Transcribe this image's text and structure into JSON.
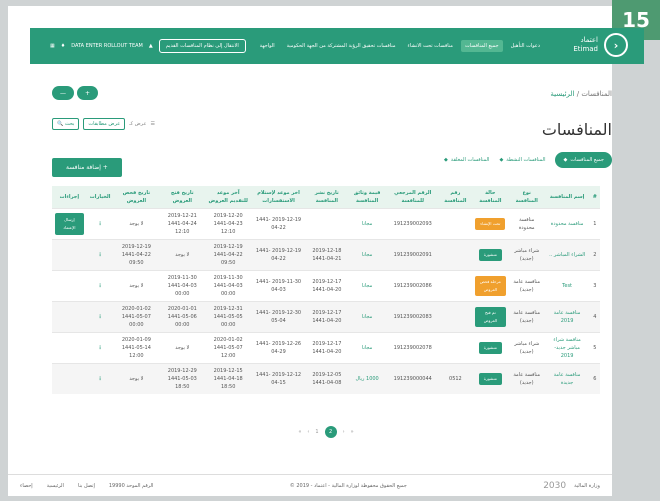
{
  "badge": "15",
  "topbar": {
    "logo_ar": "اعتماد",
    "logo_en": "Etimad",
    "nav": [
      {
        "label": "دعوات التأهيل",
        "active": false
      },
      {
        "label": "جميع المنافسات",
        "active": true
      },
      {
        "label": "منافسات تحت الانشاء",
        "active": false
      },
      {
        "label": "منافسات تحقيق الرؤية المشتركة من الجهة الحكومية",
        "active": false
      }
    ],
    "dashboard_label": "الواجهة",
    "legacy_button": "الانتقال إلى نظام المنافسات القديم",
    "user": "DATA ENTER ROLLOUT TEAM"
  },
  "breadcrumb": {
    "home": "الرئيسية",
    "sep": "/",
    "current": "المنافسات"
  },
  "pills": {
    "plus": "+",
    "collapse": "—"
  },
  "page_title": "المنافسات",
  "view": {
    "label": "عرض كـ",
    "search_label": "بحث",
    "display_label": "عرض مطابقات"
  },
  "tabs": [
    {
      "label": "جميع المنافسات",
      "active": true
    },
    {
      "label": "المنافسات النشطة",
      "active": false
    },
    {
      "label": "المنافسات المغلقة",
      "active": false
    }
  ],
  "add_button": "إضافة منافسة +",
  "table": {
    "headers": [
      "#",
      "إسم المنافسة",
      "نوع المنافسة",
      "حالة المنافسة",
      "رقم المنافسة",
      "الرقم المرجعي للمنافسة",
      "قيمة وثائق المنافسة",
      "تاريخ نشر المنافسة",
      "اخر موعد لإستلام الاستفسارات",
      "آخر موعد للتقديم العروض",
      "تاريخ فتح العروض",
      "تاريخ فحص العروض",
      "الخيارات",
      "إجراءات"
    ],
    "rows": [
      {
        "no": "1",
        "name": "منافسة محدودة",
        "type": "منافسة محدودة",
        "status": "تحت الإنشاء",
        "status_color": "#f0a02e",
        "number": "",
        "ref": "191239002093",
        "value": "مجانا",
        "published": "",
        "inquiries": "2019-12-19 1441-04-22",
        "submit": "2019-12-20 1441-04-23 12:10",
        "open": "2019-12-21 1441-04-24 12:10",
        "exam": "لا يوجد",
        "action": "إرسال الإعتماد"
      },
      {
        "no": "2",
        "name": "الشراء المباشر ..",
        "type": "شراء مباشر (جديد)",
        "status": "منشورة",
        "status_color": "#2a9b7a",
        "number": "",
        "ref": "191239002091",
        "value": "مجانا",
        "published": "2019-12-18 1441-04-21",
        "inquiries": "2019-12-19 1441-04-22",
        "submit": "2019-12-19 1441-04-22 09:50",
        "open": "لا يوجد",
        "exam": "2019-12-19 1441-04-22 09:50",
        "action": ""
      },
      {
        "no": "3",
        "name": "Test",
        "type": "منافسة عامة (جديد)",
        "status": "مرحلة فحص العروض",
        "status_color": "#f0a02e",
        "number": "",
        "ref": "191239002086",
        "value": "مجانا",
        "published": "2019-12-17 1441-04-20",
        "inquiries": "2019-11-30 1441-04-03",
        "submit": "2019-11-30 1441-04-03 00:00",
        "open": "2019-11-30 1441-04-03 00:00",
        "exam": "لا يوجد",
        "action": ""
      },
      {
        "no": "4",
        "name": "منافسة عامة 2019",
        "type": "منافسة عامة (جديد)",
        "status": "تم فتح العروض",
        "status_color": "#2a9b7a",
        "number": "",
        "ref": "191239002083",
        "value": "مجانا",
        "published": "2019-12-17 1441-04-20",
        "inquiries": "2019-12-30 1441-05-04",
        "submit": "2019-12-31 1441-05-05 00:00",
        "open": "2020-01-01 1441-05-06 00:00",
        "exam": "2020-01-02 1441-05-07 00:00",
        "action": ""
      },
      {
        "no": "5",
        "name": "منافسة شراء مباشر جديد- 2019",
        "type": "شراء مباشر (جديد)",
        "status": "منشورة",
        "status_color": "#2a9b7a",
        "number": "",
        "ref": "191239002078",
        "value": "مجانا",
        "published": "2019-12-17 1441-04-20",
        "inquiries": "2019-12-26 1441-04-29",
        "submit": "2020-01-02 1441-05-07 12:00",
        "open": "لا يوجد",
        "exam": "2020-01-09 1441-05-14 12:00",
        "action": ""
      },
      {
        "no": "6",
        "name": "منافسة عامة جديدة",
        "type": "منافسة عامة (جديد)",
        "status": "منشورة",
        "status_color": "#2a9b7a",
        "number": "0512",
        "ref": "191239000044",
        "value": "1000 ريال",
        "published": "2019-12-05 1441-04-08",
        "inquiries": "2019-12-12 1441-04-15",
        "submit": "2019-12-15 1441-04-18 18:50",
        "open": "2019-12-29 1441-05-03 18:50",
        "exam": "لا يوجد",
        "action": ""
      }
    ]
  },
  "pager": {
    "first": "«",
    "prev": "‹",
    "p1": "1",
    "p2": "2",
    "next": "›",
    "last": "»"
  },
  "footer": {
    "copyright": "© جميع الحقوق محفوظة لوزارة المالية - اعتماد - 2019",
    "vision": "2030",
    "ministry": "وزارة المالية",
    "links": [
      "إحصاء",
      "الرئيسية",
      "إتصل بنا",
      "الرقم الموحد 19990"
    ]
  }
}
